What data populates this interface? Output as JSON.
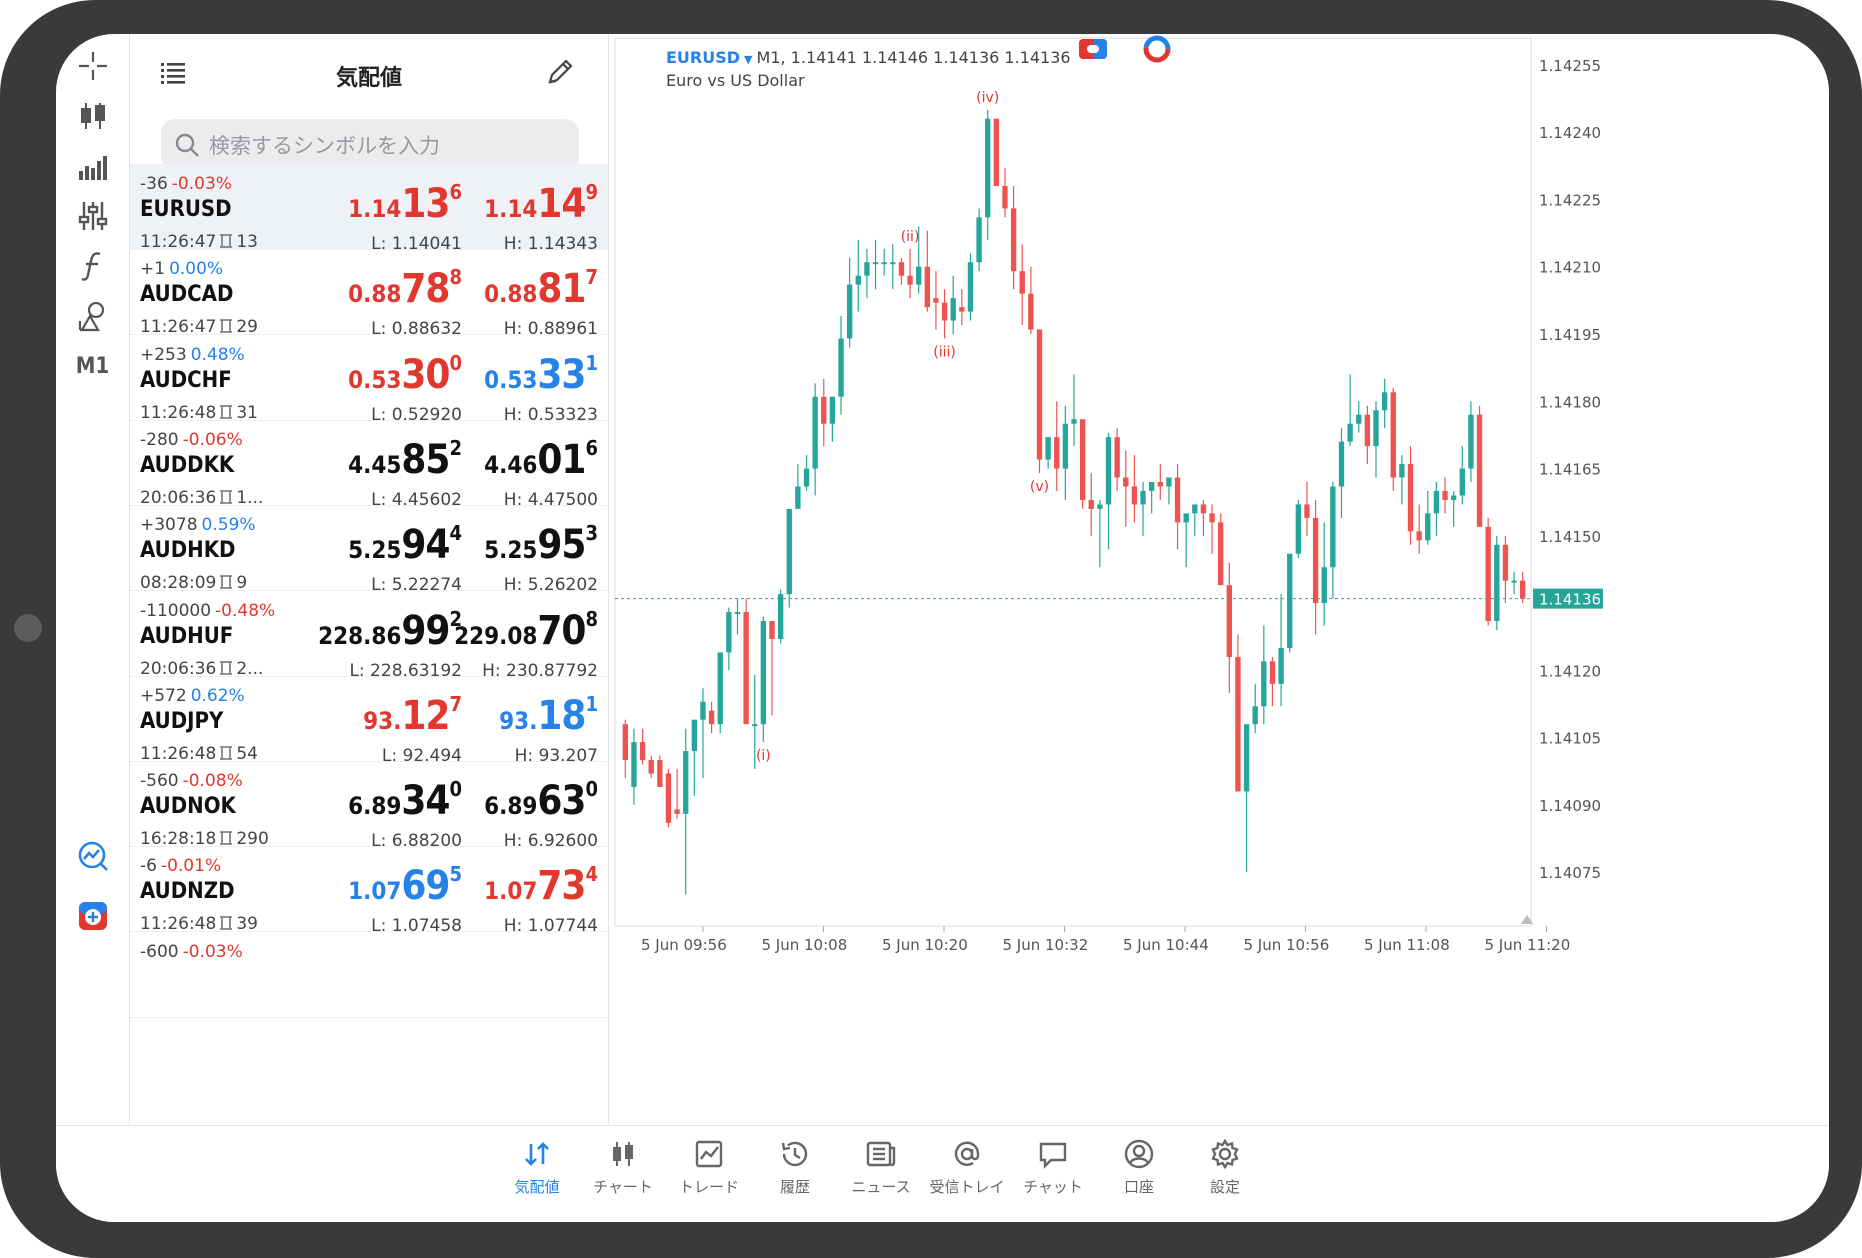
{
  "quotes_panel": {
    "title": "気配値",
    "search_placeholder": "検索するシンボルを入力",
    "rows": [
      {
        "change": "-36",
        "change_pct": "-0.03%",
        "pct_color": "red",
        "symbol": "EURUSD",
        "time": "11:26:47",
        "spread": "13",
        "bid": {
          "p1": "1.14",
          "p2": "13",
          "p3": "6",
          "color": "red"
        },
        "ask": {
          "p1": "1.14",
          "p2": "14",
          "p3": "9",
          "color": "red"
        },
        "low": "L: 1.14041",
        "high": "H: 1.14343",
        "selected": true
      },
      {
        "change": "+1",
        "change_pct": "0.00%",
        "pct_color": "blue",
        "symbol": "AUDCAD",
        "time": "11:26:47",
        "spread": "29",
        "bid": {
          "p1": "0.88",
          "p2": "78",
          "p3": "8",
          "color": "red"
        },
        "ask": {
          "p1": "0.88",
          "p2": "81",
          "p3": "7",
          "color": "red"
        },
        "low": "L: 0.88632",
        "high": "H: 0.88961"
      },
      {
        "change": "+253",
        "change_pct": "0.48%",
        "pct_color": "blue",
        "symbol": "AUDCHF",
        "time": "11:26:48",
        "spread": "31",
        "bid": {
          "p1": "0.53",
          "p2": "30",
          "p3": "0",
          "color": "red"
        },
        "ask": {
          "p1": "0.53",
          "p2": "33",
          "p3": "1",
          "color": "blue"
        },
        "low": "L: 0.52920",
        "high": "H: 0.53323"
      },
      {
        "change": "-280",
        "change_pct": "-0.06%",
        "pct_color": "red",
        "symbol": "AUDDKK",
        "time": "20:06:36",
        "spread": "1...",
        "bid": {
          "p1": "4.45",
          "p2": "85",
          "p3": "2",
          "color": "black"
        },
        "ask": {
          "p1": "4.46",
          "p2": "01",
          "p3": "6",
          "color": "black"
        },
        "low": "L: 4.45602",
        "high": "H: 4.47500"
      },
      {
        "change": "+3078",
        "change_pct": "0.59%",
        "pct_color": "blue",
        "symbol": "AUDHKD",
        "time": "08:28:09",
        "spread": "9",
        "bid": {
          "p1": "5.25",
          "p2": "94",
          "p3": "4",
          "color": "black"
        },
        "ask": {
          "p1": "5.25",
          "p2": "95",
          "p3": "3",
          "color": "black"
        },
        "low": "L: 5.22274",
        "high": "H: 5.26202"
      },
      {
        "change": "-110000",
        "change_pct": "-0.48%",
        "pct_color": "red",
        "symbol": "AUDHUF",
        "time": "20:06:36",
        "spread": "2...",
        "bid": {
          "p1": "228.86",
          "p2": "99",
          "p3": "2",
          "color": "black"
        },
        "ask": {
          "p1": "229.08",
          "p2": "70",
          "p3": "8",
          "color": "black"
        },
        "low": "L: 228.63192",
        "high": "H: 230.87792"
      },
      {
        "change": "+572",
        "change_pct": "0.62%",
        "pct_color": "blue",
        "symbol": "AUDJPY",
        "time": "11:26:48",
        "spread": "54",
        "bid": {
          "p1": "93.",
          "p2": "12",
          "p3": "7",
          "color": "red"
        },
        "ask": {
          "p1": "93.",
          "p2": "18",
          "p3": "1",
          "color": "blue"
        },
        "low": "L: 92.494",
        "high": "H: 93.207"
      },
      {
        "change": "-560",
        "change_pct": "-0.08%",
        "pct_color": "red",
        "symbol": "AUDNOK",
        "time": "16:28:18",
        "spread": "290",
        "bid": {
          "p1": "6.89",
          "p2": "34",
          "p3": "0",
          "color": "black"
        },
        "ask": {
          "p1": "6.89",
          "p2": "63",
          "p3": "0",
          "color": "black"
        },
        "low": "L: 6.88200",
        "high": "H: 6.92600"
      },
      {
        "change": "-6",
        "change_pct": "-0.01%",
        "pct_color": "red",
        "symbol": "AUDNZD",
        "time": "11:26:48",
        "spread": "39",
        "bid": {
          "p1": "1.07",
          "p2": "69",
          "p3": "5",
          "color": "blue"
        },
        "ask": {
          "p1": "1.07",
          "p2": "73",
          "p3": "4",
          "color": "red"
        },
        "low": "L: 1.07458",
        "high": "H: 1.07744"
      },
      {
        "change": "-600",
        "change_pct": "-0.03%",
        "pct_color": "red",
        "symbol": "",
        "time": "",
        "spread": "",
        "bid": {
          "p1": "",
          "p2": "",
          "p3": "",
          "color": "black"
        },
        "ask": {
          "p1": "",
          "p2": "",
          "p3": "",
          "color": "black"
        },
        "low": "",
        "high": ""
      }
    ]
  },
  "toolbar": {
    "timeframe": "M1",
    "tools": [
      "crosshair-icon",
      "candlestick-icon",
      "indicators-icon",
      "settings-sliders-icon",
      "function-icon",
      "objects-icon"
    ],
    "bottom_tools": [
      "chart-analysis-icon",
      "new-order-icon"
    ]
  },
  "chart": {
    "symbol": "EURUSD",
    "ohlc_text": "M1, 1.14141 1.14146 1.14136 1.14136",
    "description": "Euro vs US Dollar",
    "current_price_label": "1.14136",
    "colors": {
      "up": "#26a69a",
      "down": "#ef5350",
      "price_line": "#26a69a",
      "grid": "#f2f2f2",
      "wave_label": "#e0382e"
    }
  },
  "chart_data": {
    "type": "candlestick",
    "y_ticks": [
      "1.14255",
      "1.14240",
      "1.14225",
      "1.14210",
      "1.14195",
      "1.14180",
      "1.14165",
      "1.14150",
      "1.14136",
      "1.14120",
      "1.14105",
      "1.14090",
      "1.14075"
    ],
    "x_ticks": [
      "5 Jun 09:56",
      "5 Jun 10:08",
      "5 Jun 10:20",
      "5 Jun 10:32",
      "5 Jun 10:44",
      "5 Jun 10:56",
      "5 Jun 11:08",
      "5 Jun 11:20"
    ],
    "ylim": [
      1.14063,
      1.14261
    ],
    "current_price": 1.14136,
    "candles": [
      [
        1.14108,
        1.14109,
        1.14096,
        1.141
      ],
      [
        1.14094,
        1.14107,
        1.1409,
        1.14104
      ],
      [
        1.14104,
        1.14107,
        1.14099,
        1.141
      ],
      [
        1.141,
        1.14101,
        1.14096,
        1.14097
      ],
      [
        1.141,
        1.14101,
        1.14094,
        1.14094
      ],
      [
        1.14097,
        1.14098,
        1.14085,
        1.14086
      ],
      [
        1.14089,
        1.14098,
        1.14087,
        1.14088
      ],
      [
        1.14088,
        1.14107,
        1.1407,
        1.14102
      ],
      [
        1.14102,
        1.14107,
        1.14092,
        1.14109
      ],
      [
        1.14109,
        1.14116,
        1.14096,
        1.14113
      ],
      [
        1.14111,
        1.14113,
        1.14106,
        1.14108
      ],
      [
        1.14108,
        1.14124,
        1.14106,
        1.14124
      ],
      [
        1.14124,
        1.14134,
        1.1412,
        1.14133
      ],
      [
        1.14133,
        1.14136,
        1.14128,
        1.14133
      ],
      [
        1.14133,
        1.14136,
        1.14108,
        1.14108
      ],
      [
        1.14108,
        1.14119,
        1.14098,
        1.14108
      ],
      [
        1.14108,
        1.14132,
        1.14104,
        1.14131
      ],
      [
        1.14131,
        1.14127,
        1.1411,
        1.14127
      ],
      [
        1.14127,
        1.14138,
        1.14126,
        1.14137
      ],
      [
        1.14137,
        1.14156,
        1.14134,
        1.14156
      ],
      [
        1.14156,
        1.14166,
        1.1416,
        1.14161
      ],
      [
        1.14161,
        1.14168,
        1.1416,
        1.14165
      ],
      [
        1.14165,
        1.14184,
        1.14159,
        1.14181
      ],
      [
        1.14181,
        1.14185,
        1.1417,
        1.14175
      ],
      [
        1.14175,
        1.14181,
        1.14171,
        1.14181
      ],
      [
        1.14181,
        1.14199,
        1.14177,
        1.14194
      ],
      [
        1.14194,
        1.14212,
        1.14192,
        1.14206
      ],
      [
        1.14206,
        1.14216,
        1.142,
        1.14208
      ],
      [
        1.14208,
        1.14214,
        1.14203,
        1.14211
      ],
      [
        1.14211,
        1.14216,
        1.14205,
        1.14211
      ],
      [
        1.14211,
        1.14214,
        1.14208,
        1.14211
      ],
      [
        1.14211,
        1.14215,
        1.14205,
        1.14211
      ],
      [
        1.14211,
        1.14212,
        1.14206,
        1.14208
      ],
      [
        1.14208,
        1.14214,
        1.14203,
        1.14206
      ],
      [
        1.14206,
        1.14219,
        1.14204,
        1.1421
      ],
      [
        1.1421,
        1.14218,
        1.142,
        1.14201
      ],
      [
        1.14203,
        1.14209,
        1.14196,
        1.14202
      ],
      [
        1.14202,
        1.14205,
        1.14194,
        1.14198
      ],
      [
        1.14198,
        1.14208,
        1.14195,
        1.14203
      ],
      [
        1.14201,
        1.14205,
        1.14197,
        1.142
      ],
      [
        1.142,
        1.14213,
        1.14198,
        1.14211
      ],
      [
        1.14211,
        1.14223,
        1.14209,
        1.14221
      ],
      [
        1.14221,
        1.14245,
        1.14216,
        1.14243
      ],
      [
        1.14243,
        1.14243,
        1.14228,
        1.14228
      ],
      [
        1.14228,
        1.14232,
        1.14221,
        1.14223
      ],
      [
        1.14223,
        1.14228,
        1.14205,
        1.14209
      ],
      [
        1.14209,
        1.14215,
        1.14197,
        1.14204
      ],
      [
        1.14204,
        1.1421,
        1.14195,
        1.14196
      ],
      [
        1.14196,
        1.14196,
        1.14164,
        1.14167
      ],
      [
        1.14167,
        1.14172,
        1.14165,
        1.14172
      ],
      [
        1.14172,
        1.1418,
        1.1416,
        1.14165
      ],
      [
        1.14165,
        1.14179,
        1.14158,
        1.14175
      ],
      [
        1.14175,
        1.14186,
        1.1417,
        1.14176
      ],
      [
        1.14176,
        1.14174,
        1.14156,
        1.14158
      ],
      [
        1.14158,
        1.14164,
        1.1415,
        1.14156
      ],
      [
        1.14156,
        1.14158,
        1.14143,
        1.14157
      ],
      [
        1.14157,
        1.14173,
        1.14147,
        1.14172
      ],
      [
        1.14172,
        1.14174,
        1.1416,
        1.14163
      ],
      [
        1.14163,
        1.14169,
        1.14152,
        1.14161
      ],
      [
        1.14161,
        1.14168,
        1.14153,
        1.14157
      ],
      [
        1.14157,
        1.14162,
        1.1415,
        1.1416
      ],
      [
        1.1416,
        1.14162,
        1.14155,
        1.14162
      ],
      [
        1.14162,
        1.14166,
        1.14158,
        1.14161
      ],
      [
        1.14161,
        1.14163,
        1.14157,
        1.14163
      ],
      [
        1.14163,
        1.14166,
        1.14147,
        1.14153
      ],
      [
        1.14153,
        1.14155,
        1.14143,
        1.14155
      ],
      [
        1.14155,
        1.14157,
        1.1415,
        1.14157
      ],
      [
        1.14157,
        1.14158,
        1.1415,
        1.14155
      ],
      [
        1.14155,
        1.14157,
        1.14146,
        1.14153
      ],
      [
        1.14153,
        1.14155,
        1.14139,
        1.14139
      ],
      [
        1.14139,
        1.14144,
        1.14115,
        1.14123
      ],
      [
        1.14123,
        1.14128,
        1.14098,
        1.14093
      ],
      [
        1.14093,
        1.14106,
        1.14075,
        1.14108
      ],
      [
        1.14108,
        1.14117,
        1.14106,
        1.14112
      ],
      [
        1.14112,
        1.1413,
        1.14108,
        1.14122
      ],
      [
        1.14122,
        1.14123,
        1.14112,
        1.14117
      ],
      [
        1.14117,
        1.14137,
        1.14112,
        1.14125
      ],
      [
        1.14125,
        1.14142,
        1.14124,
        1.14146
      ],
      [
        1.14146,
        1.14158,
        1.14145,
        1.14157
      ],
      [
        1.14157,
        1.14162,
        1.1415,
        1.14154
      ],
      [
        1.14154,
        1.14158,
        1.14128,
        1.14135
      ],
      [
        1.14135,
        1.14153,
        1.1413,
        1.14143
      ],
      [
        1.14143,
        1.14162,
        1.14136,
        1.14161
      ],
      [
        1.14161,
        1.14174,
        1.14154,
        1.14171
      ],
      [
        1.14171,
        1.14186,
        1.1417,
        1.14175
      ],
      [
        1.14175,
        1.1418,
        1.14173,
        1.14177
      ],
      [
        1.14177,
        1.14179,
        1.14166,
        1.1417
      ],
      [
        1.1417,
        1.1418,
        1.14163,
        1.14178
      ],
      [
        1.14178,
        1.14185,
        1.14174,
        1.14182
      ],
      [
        1.14182,
        1.14183,
        1.1416,
        1.14163
      ],
      [
        1.14163,
        1.14168,
        1.14157,
        1.14166
      ],
      [
        1.14166,
        1.1417,
        1.14148,
        1.14151
      ],
      [
        1.14151,
        1.14157,
        1.14146,
        1.14149
      ],
      [
        1.14149,
        1.1416,
        1.14148,
        1.14155
      ],
      [
        1.14155,
        1.14162,
        1.1415,
        1.1416
      ],
      [
        1.1416,
        1.14163,
        1.14155,
        1.14158
      ],
      [
        1.14158,
        1.1416,
        1.14152,
        1.14159
      ],
      [
        1.14159,
        1.1417,
        1.14157,
        1.14165
      ],
      [
        1.14165,
        1.1418,
        1.14162,
        1.14177
      ],
      [
        1.14177,
        1.14179,
        1.14155,
        1.14152
      ],
      [
        1.14152,
        1.14154,
        1.1413,
        1.14131
      ],
      [
        1.14131,
        1.1415,
        1.14129,
        1.14148
      ],
      [
        1.14148,
        1.1415,
        1.14135,
        1.1414
      ],
      [
        1.1414,
        1.14142,
        1.14137,
        1.1414
      ],
      [
        1.1414,
        1.14142,
        1.14135,
        1.14136
      ]
    ],
    "annotations": [
      {
        "label": "(i)",
        "index": 16,
        "position": "below"
      },
      {
        "label": "(ii)",
        "index": 33,
        "position": "above"
      },
      {
        "label": "(iii)",
        "index": 37,
        "position": "below"
      },
      {
        "label": "(iv)",
        "index": 42,
        "position": "above"
      },
      {
        "label": "(v)",
        "index": 48,
        "position": "below"
      }
    ]
  },
  "tabbar": {
    "tabs": [
      {
        "label": "気配値",
        "active": true
      },
      {
        "label": "チャート"
      },
      {
        "label": "トレード"
      },
      {
        "label": "履歴"
      },
      {
        "label": "ニュース"
      },
      {
        "label": "受信トレイ"
      },
      {
        "label": "チャット"
      },
      {
        "label": "口座"
      },
      {
        "label": "設定"
      }
    ]
  }
}
